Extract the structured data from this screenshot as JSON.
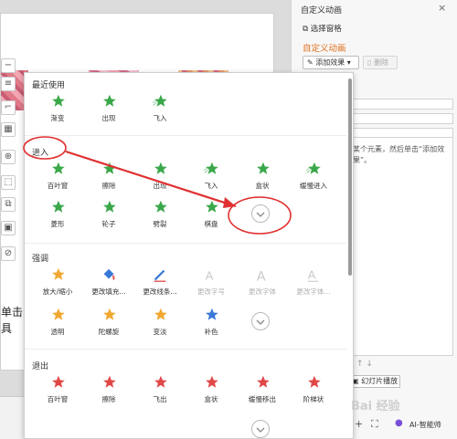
{
  "pane": {
    "title": "自定义动画",
    "close": "×",
    "select_pane": "选择窗格",
    "heading": "自定义动画",
    "add_effect": "添加效果",
    "delete": "删除",
    "note": "某个元素，然后单击“添加效果”。",
    "play": "幻灯片播放",
    "ai": "AI-智能帅"
  },
  "panel": {
    "recent": {
      "title": "最近使用",
      "items": [
        {
          "label": "渐变",
          "icon": "star-green-icon"
        },
        {
          "label": "出现",
          "icon": "star-green-icon"
        },
        {
          "label": "飞入",
          "icon": "star-green-fly-icon"
        }
      ]
    },
    "enter": {
      "title": "进入",
      "items": [
        {
          "label": "百叶窗",
          "icon": "star-green-icon"
        },
        {
          "label": "擦除",
          "icon": "star-green-icon"
        },
        {
          "label": "出现",
          "icon": "star-green-icon"
        },
        {
          "label": "飞入",
          "icon": "star-green-fly-icon"
        },
        {
          "label": "盒状",
          "icon": "star-green-icon"
        },
        {
          "label": "缓慢进入",
          "icon": "star-green-fly-icon"
        },
        {
          "label": "菱形",
          "icon": "star-green-icon"
        },
        {
          "label": "轮子",
          "icon": "star-green-icon"
        },
        {
          "label": "劈裂",
          "icon": "star-green-icon"
        },
        {
          "label": "棋盘",
          "icon": "star-green-icon"
        }
      ]
    },
    "emphasis": {
      "title": "强调",
      "items": [
        {
          "label": "放大/缩小",
          "icon": "star-yellow-icon"
        },
        {
          "label": "更改填充...",
          "icon": "fill-bucket-icon"
        },
        {
          "label": "更改线条...",
          "icon": "pen-icon"
        },
        {
          "label": "更改字号",
          "icon": "font-size-icon"
        },
        {
          "label": "更改字体",
          "icon": "font-icon"
        },
        {
          "label": "更改字体...",
          "icon": "font-underline-icon"
        },
        {
          "label": "透明",
          "icon": "star-yellow-icon"
        },
        {
          "label": "陀螺旋",
          "icon": "star-yellow-icon"
        },
        {
          "label": "变淡",
          "icon": "star-yellow-icon"
        },
        {
          "label": "补色",
          "icon": "star-blue-icon"
        }
      ]
    },
    "exit": {
      "title": "退出",
      "items": [
        {
          "label": "百叶窗",
          "icon": "star-red-icon"
        },
        {
          "label": "擦除",
          "icon": "star-red-icon"
        },
        {
          "label": "飞出",
          "icon": "star-red-icon"
        },
        {
          "label": "盒状",
          "icon": "star-red-icon"
        },
        {
          "label": "缓慢移出",
          "icon": "star-red-icon"
        },
        {
          "label": "阶梯状",
          "icon": "star-red-icon"
        }
      ]
    }
  },
  "slide": {
    "text1": "单击",
    "text2": "具"
  },
  "watermark": "Bai 经验",
  "colors": {
    "green": "#3aa84a",
    "red": "#e04848",
    "yellow": "#f0a830",
    "blue": "#3a78d8",
    "accent": "#e0701c",
    "annotation": "#e03030"
  }
}
